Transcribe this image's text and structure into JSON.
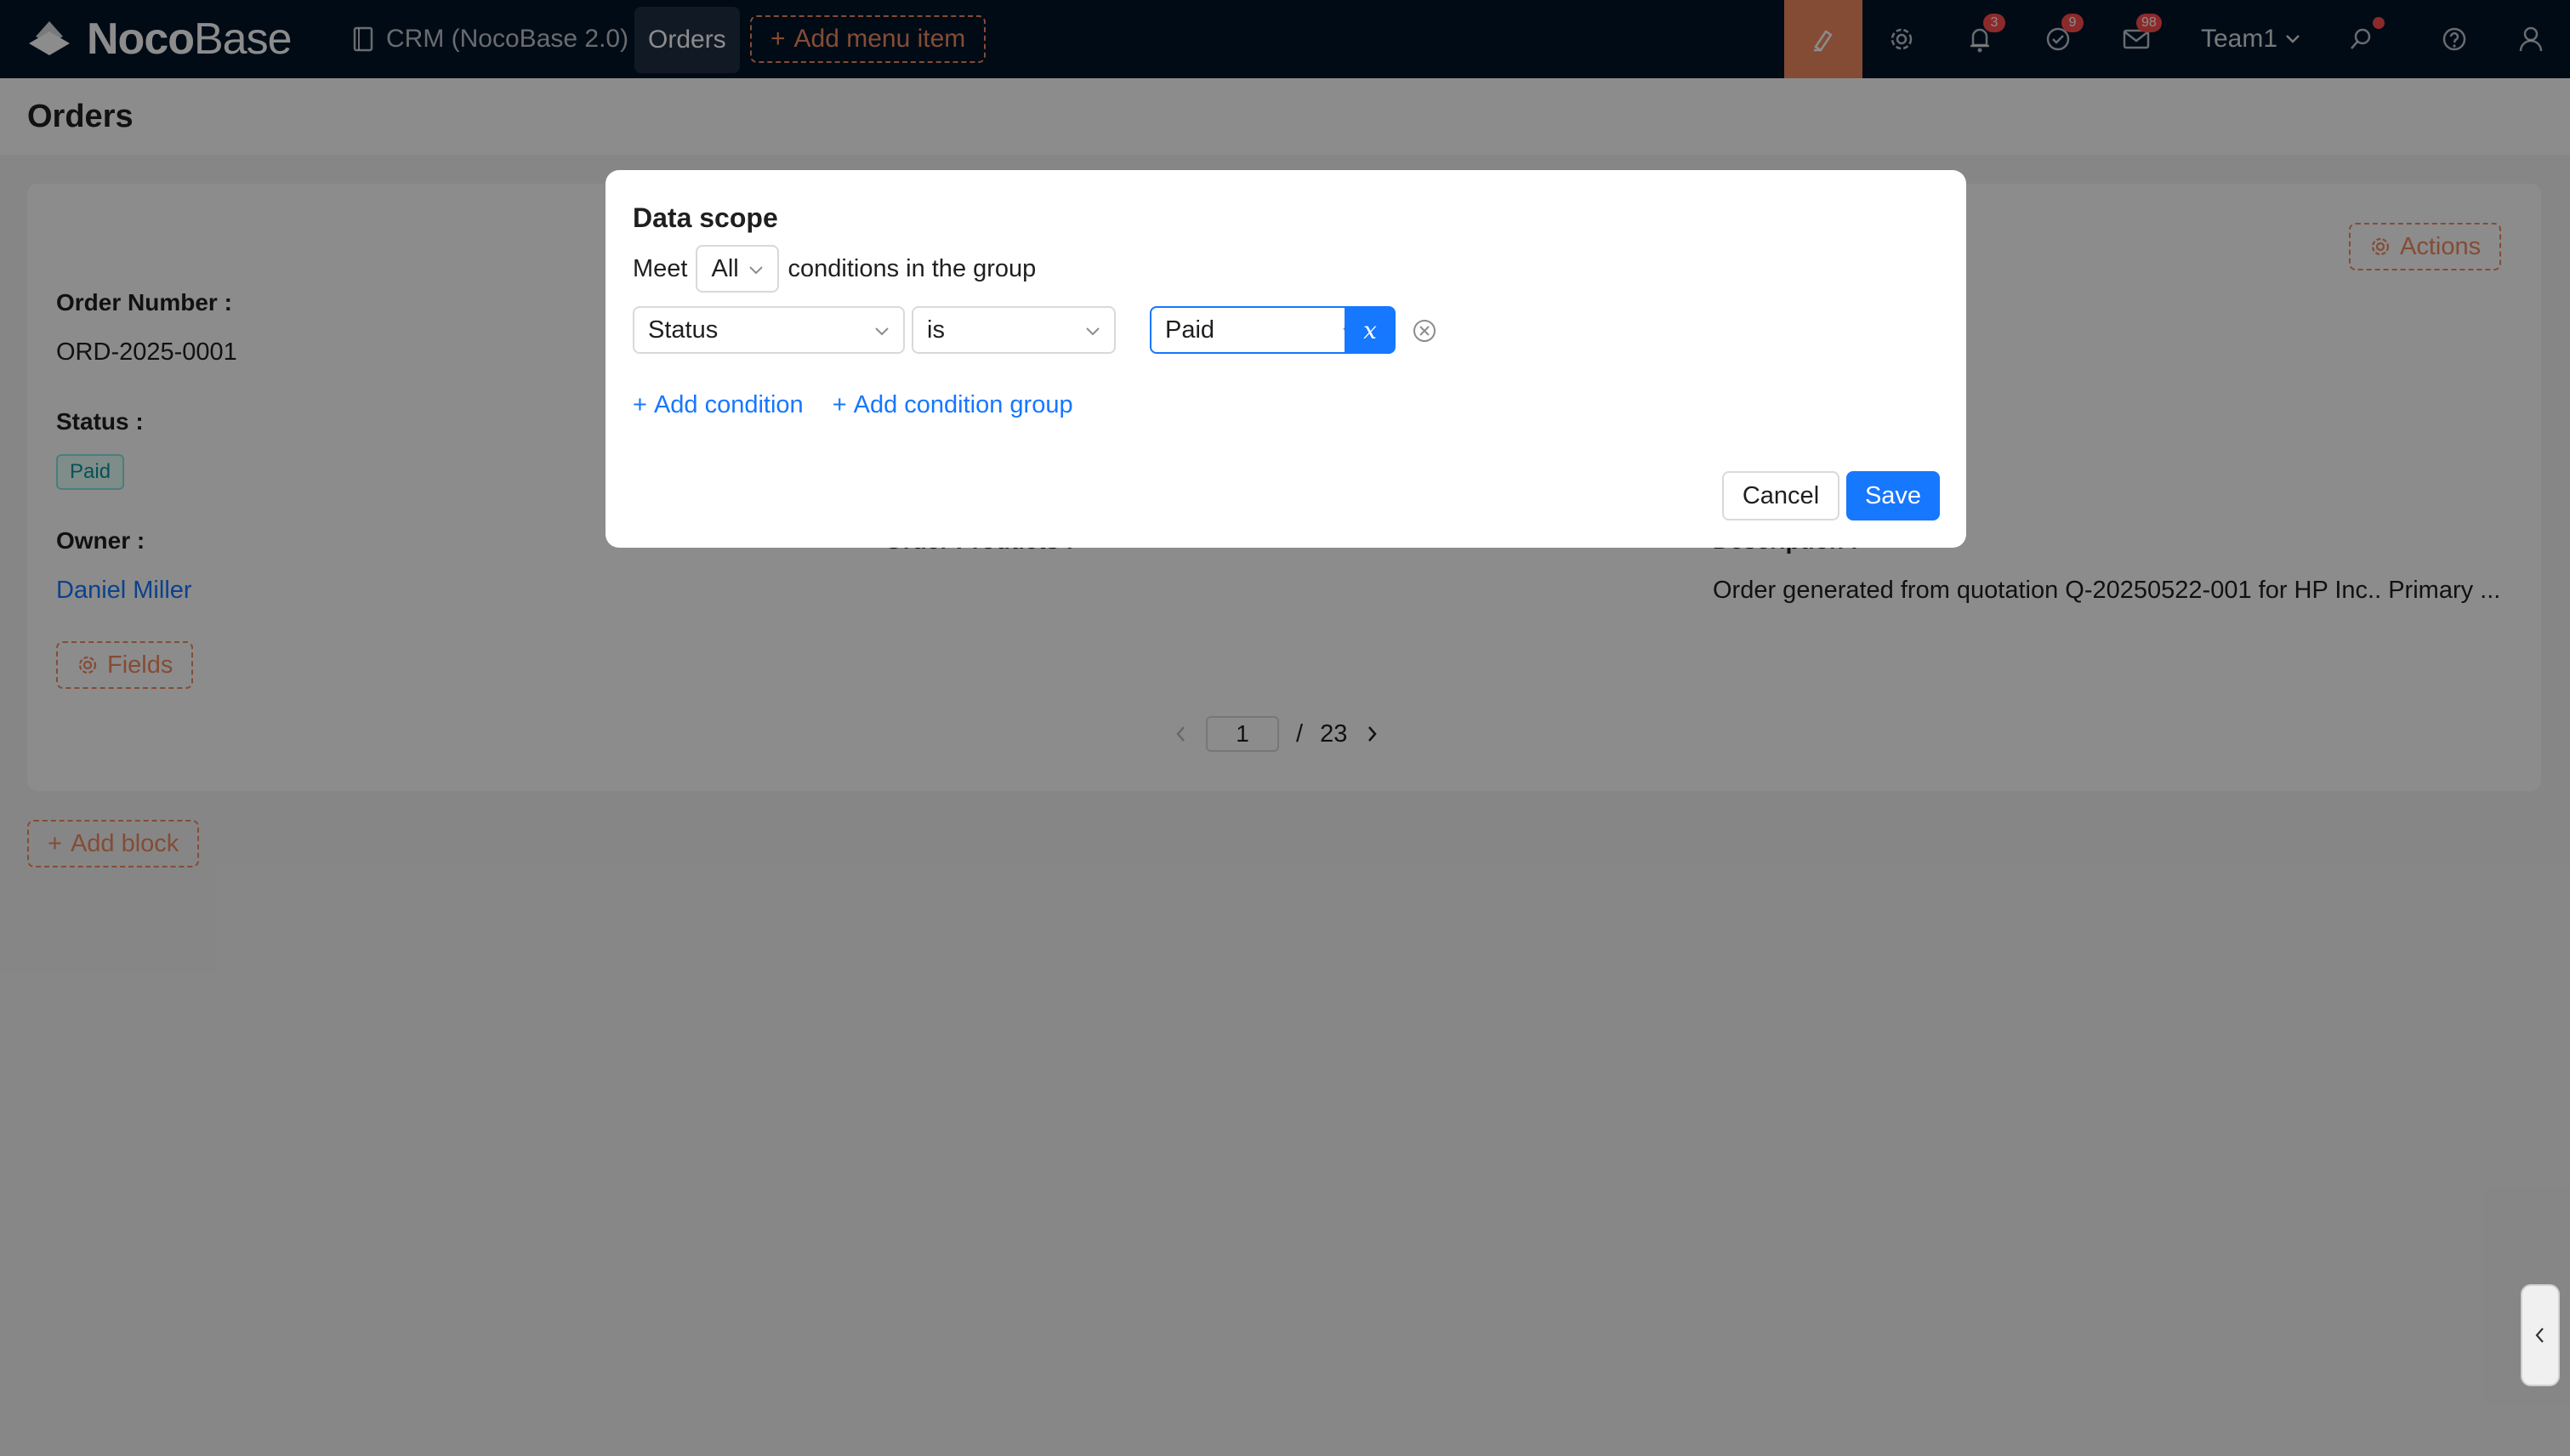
{
  "app": {
    "logo_bold": "Noco",
    "logo_light": "Base"
  },
  "topbar": {
    "menu_crm": "CRM (NocoBase 2.0)",
    "menu_orders": "Orders",
    "add_menu_item": "Add menu item",
    "badges": {
      "notifications": "3",
      "tasks": "9",
      "messages": "98"
    },
    "team": "Team1",
    "colors": {
      "background": "#001529",
      "accent": "#f18b62",
      "badge": "#ff4d4f"
    }
  },
  "page": {
    "title": "Orders",
    "actions_label": "Actions",
    "fields": {
      "order_number_label": "Order Number :",
      "order_number_value": "ORD-2025-0001",
      "status_label": "Status :",
      "status_value": "Paid",
      "owner_label": "Owner :",
      "owner_value": "Daniel Miller",
      "order_products_label": "Order Products :",
      "description_label": "Description :",
      "description_value": "Order generated from quotation Q-20250522-001 for HP Inc.. Primary ..."
    },
    "fields_button": "Fields",
    "pagination": {
      "current": "1",
      "separator": "/",
      "total": "23"
    },
    "add_block": "Add block"
  },
  "modal": {
    "title": "Data scope",
    "meet_prefix": "Meet",
    "meet_value": "All",
    "meet_suffix": "conditions in the group",
    "condition": {
      "field": "Status",
      "operator": "is",
      "value": "Paid",
      "variable_symbol": "x"
    },
    "add_condition": "Add condition",
    "add_condition_group": "Add condition group",
    "cancel": "Cancel",
    "save": "Save",
    "colors": {
      "primary": "#1677ff"
    }
  }
}
